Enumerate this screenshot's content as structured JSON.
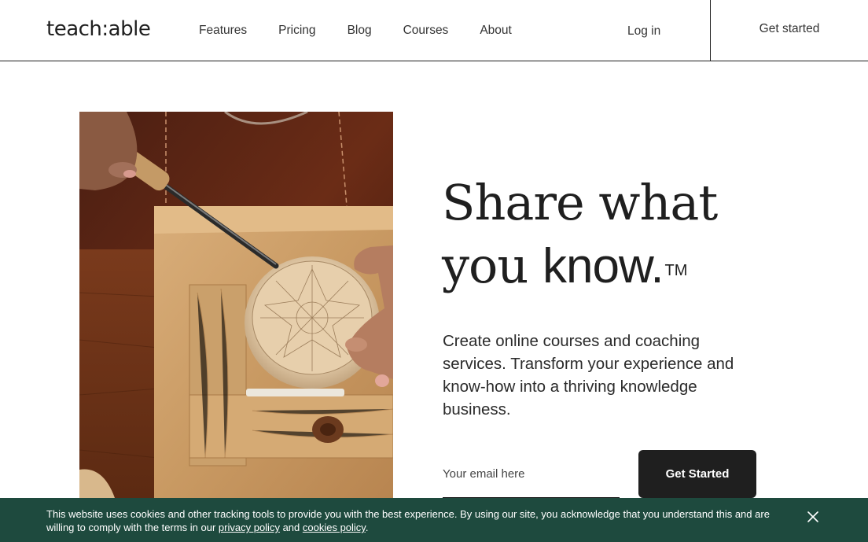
{
  "header": {
    "logo": "teach:able",
    "nav": [
      "Features",
      "Pricing",
      "Blog",
      "Courses",
      "About"
    ],
    "login": "Log in",
    "get_started": "Get started"
  },
  "hero": {
    "headline_line1": "Share what",
    "headline_line2_serif": "you ",
    "headline_line2_sans": "know.",
    "trademark": "TM",
    "subtext": "Create online courses and coaching services. Transform your experience and know-how into a thriving knowledge business.",
    "email_placeholder": "Your email here",
    "cta": "Get Started"
  },
  "cookie_banner": {
    "text_before": "This website uses cookies and other tracking tools to provide you with the best experience. By using our site, you acknowledge that you understand this and are willing to comply with the terms in our ",
    "privacy_link": "privacy policy",
    "middle": " and ",
    "cookies_link": "cookies policy",
    "text_after": ".",
    "bg_color": "#1e4a3e"
  },
  "icons": {
    "close": "close-icon"
  }
}
